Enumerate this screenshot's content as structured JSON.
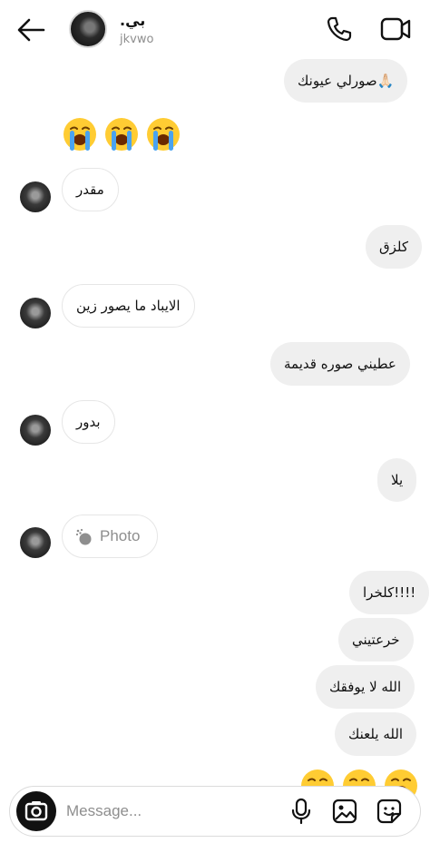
{
  "header": {
    "name": ".بي",
    "username": "jkvwo"
  },
  "messages": [
    {
      "dir": "out",
      "text": "صورلي عيونك🙏🏻"
    },
    {
      "dir": "in",
      "text": "😭😭😭"
    },
    {
      "dir": "in",
      "text": "مقدر"
    },
    {
      "dir": "out",
      "text": "كلزق"
    },
    {
      "dir": "in",
      "text": "الايباد ما يصور زين"
    },
    {
      "dir": "out",
      "text": "عطيني صوره قديمة"
    },
    {
      "dir": "in",
      "text": "بدور"
    },
    {
      "dir": "out",
      "text": "يلا"
    },
    {
      "dir": "in",
      "photo_label": "Photo"
    },
    {
      "dir": "out",
      "text": "كلخرا!!!!"
    },
    {
      "dir": "out",
      "text": "خرعتيني"
    },
    {
      "dir": "out",
      "text": "الله لا يوفقك"
    },
    {
      "dir": "out",
      "text": "الله يلعنك"
    },
    {
      "dir": "out",
      "text": "😭😭😭"
    }
  ],
  "composer": {
    "placeholder": "Message..."
  },
  "icons": {
    "back": "arrow-left-icon",
    "call": "phone-icon",
    "video": "video-camera-icon",
    "camera": "camera-icon",
    "mic": "microphone-icon",
    "gallery": "image-icon",
    "sticker": "sticker-icon"
  },
  "colors": {
    "outgoing_bubble": "#efefef",
    "incoming_bubble": "#ffffff",
    "emoji_yellow": "#ffcc33",
    "emoji_tears": "#4aa3f0"
  }
}
